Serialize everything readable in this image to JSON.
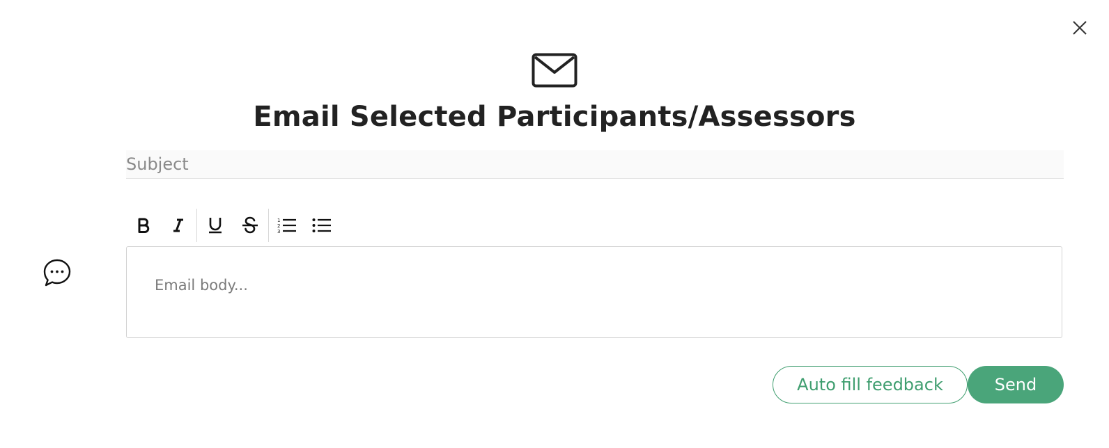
{
  "dialog": {
    "title": "Email Selected Participants/Assessors",
    "header_icon": "envelope-icon",
    "close_icon": "close-icon"
  },
  "subject": {
    "placeholder": "Subject",
    "value": ""
  },
  "toolbar": {
    "buttons": [
      {
        "name": "bold",
        "icon": "bold-icon"
      },
      {
        "name": "italic",
        "icon": "italic-icon"
      },
      {
        "name": "underline",
        "icon": "underline-icon"
      },
      {
        "name": "strikethrough",
        "icon": "strikethrough-icon"
      },
      {
        "name": "ordered-list",
        "icon": "ordered-list-icon"
      },
      {
        "name": "bullet-list",
        "icon": "bullet-list-icon"
      }
    ]
  },
  "body": {
    "placeholder": "Email body...",
    "value": ""
  },
  "side": {
    "chat_icon": "chat-bubble-icon"
  },
  "actions": {
    "autofill_label": "Auto fill feedback",
    "send_label": "Send"
  },
  "colors": {
    "accent": "#4aa57a",
    "accent_text": "#3f9e6f",
    "title_text": "#222222",
    "placeholder_text": "#8a8a8a"
  }
}
